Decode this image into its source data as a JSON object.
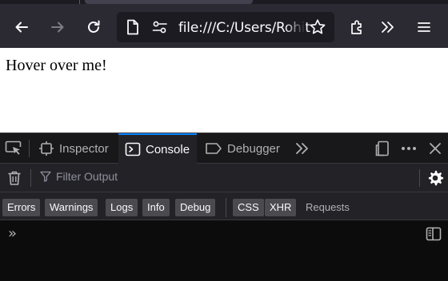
{
  "browser": {
    "url": "file:///C:/Users/Rohit",
    "icons": {
      "back": "arrow-left-icon",
      "forward": "arrow-right-icon",
      "reload": "reload-icon",
      "page": "document-icon",
      "permissions": "permissions-icon",
      "bookmark": "star-icon",
      "extensions": "puzzle-icon",
      "overflow": "chevrons-icon",
      "menu": "hamburger-icon"
    }
  },
  "page": {
    "text": "Hover over me!"
  },
  "devtools": {
    "tabs": [
      {
        "label": "Inspector",
        "icon": "inspector-icon"
      },
      {
        "label": "Console",
        "icon": "console-icon",
        "selected": true
      },
      {
        "label": "Debugger",
        "icon": "debugger-icon"
      }
    ],
    "filter_placeholder": "Filter Output",
    "levels": [
      "Errors",
      "Warnings",
      "Logs",
      "Info",
      "Debug"
    ],
    "categories": [
      "CSS",
      "XHR"
    ],
    "requests_label": "Requests",
    "prompt": "»",
    "colors": {
      "accent": "#0a84ff",
      "toolbar_bg": "#18181a",
      "panel_bg": "#232327",
      "console_bg": "#0c0c0d"
    }
  }
}
